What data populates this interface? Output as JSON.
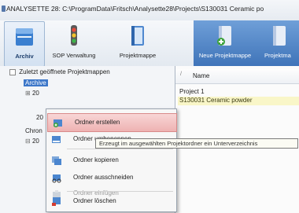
{
  "window": {
    "title": "ANALYSETTE 28: C:\\ProgramData\\Fritsch\\Analysette28\\Projects\\S130031 Ceramic po"
  },
  "ribbon": {
    "archiv_label": "Archiv",
    "sop_label": "SOP Verwaltung",
    "projektmappe_label": "Projektmappe",
    "neue_projektmappe_label": "Neue Projektmappe",
    "projektmappe_right_label": "Projektma"
  },
  "tree": {
    "header": "Zuletzt geöffnete Projektmappen",
    "archive_label": "Archive",
    "year_1": "20",
    "year_2": "20",
    "chron_label": "Chron",
    "year_3": "20"
  },
  "list": {
    "column_name": "Name",
    "rows": [
      "Project 1",
      "S130031 Ceramic powder"
    ]
  },
  "context_menu": {
    "items": [
      {
        "label": "Ordner erstellen"
      },
      {
        "label": "Ordner umbenennen"
      },
      {
        "label": "Ordner kopieren"
      },
      {
        "label": "Ordner ausschneiden"
      },
      {
        "label": "Ordner einfügen"
      },
      {
        "label": "Ordner löschen"
      }
    ]
  },
  "tooltip": {
    "text": "Erzeugt im ausgewählten Projektordner ein Unterverzeichnis"
  },
  "colors": {
    "ribbon_accent": "#3f74b9",
    "menu_highlight": "#eeb2b2",
    "row_selected": "#f9f6c8"
  }
}
